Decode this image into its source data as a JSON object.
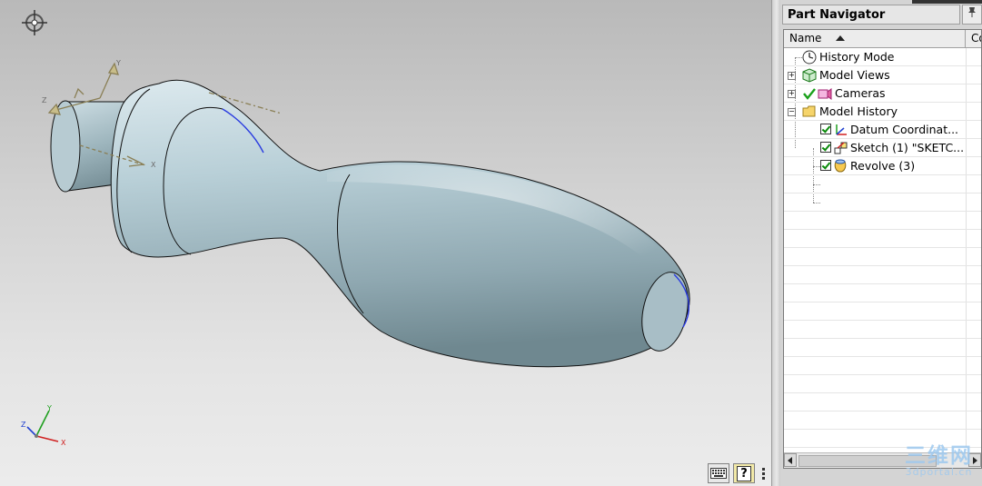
{
  "navigator": {
    "title": "Part Navigator",
    "title_button_icon": "pin-icon",
    "column_name": "Name",
    "column_second": "Co",
    "rows": [
      {
        "label": "History Mode",
        "icon": "clock-icon",
        "expanded": null
      },
      {
        "label": "Model Views",
        "icon": "cube-views-icon",
        "expanded": false
      },
      {
        "label": "Cameras",
        "icon": "camera-icon",
        "expanded": false
      },
      {
        "label": "Model History",
        "icon": "folder-icon",
        "expanded": true
      },
      {
        "label": "Datum Coordinat...",
        "icon": "datum-csys-icon",
        "checked": true
      },
      {
        "label": "Sketch (1) \"SKETC...",
        "icon": "sketch-icon",
        "checked": true
      },
      {
        "label": "Revolve (3)",
        "icon": "revolve-icon",
        "checked": true
      }
    ]
  },
  "viewport": {
    "triad_labels": {
      "x": "X",
      "y": "Y",
      "z": "Z"
    },
    "datum_labels": {
      "x": "X",
      "y": "Y",
      "z": "Z"
    },
    "status_icons": [
      "keyboard-icon",
      "help-icon",
      "more-icon"
    ],
    "help_glyph": "?",
    "colors": {
      "model": "#a9c2cc",
      "x_axis": "#d02020",
      "y_axis": "#20a020",
      "z_axis": "#2040d0",
      "edge_highlight": "#2a3ce0"
    }
  },
  "watermark": {
    "main": "三维网",
    "sub": "3dportal.cn"
  }
}
